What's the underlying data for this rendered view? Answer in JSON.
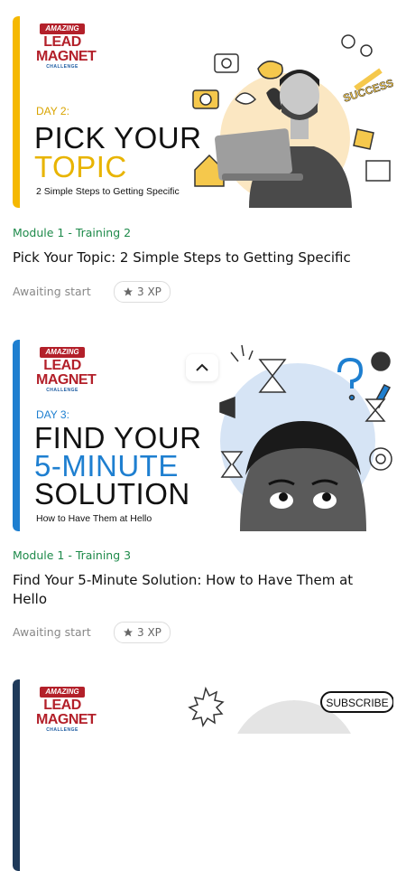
{
  "colors": {
    "accent_yellow": "#f5b800",
    "accent_blue": "#1e7fd0",
    "module_green": "#1e8a4a"
  },
  "cards": [
    {
      "logo": {
        "line1": "AMAZING",
        "line2": "LEAD",
        "line3": "MAGNET",
        "line4": "CHALLENGE"
      },
      "day": "DAY 2:",
      "headline": [
        "PICK YOUR",
        "TOPIC"
      ],
      "tagline": "2 Simple Steps to Getting Specific",
      "module": "Module 1 - Training 2",
      "title": "Pick Your Topic: 2 Simple Steps to Getting Specific",
      "status": "Awaiting start",
      "xp": "3 XP"
    },
    {
      "logo": {
        "line1": "AMAZING",
        "line2": "LEAD",
        "line3": "MAGNET",
        "line4": "CHALLENGE"
      },
      "day": "DAY 3:",
      "headline": [
        "FIND YOUR",
        "5-MINUTE",
        "SOLUTION"
      ],
      "tagline": "How to Have Them at Hello",
      "module": "Module 1 - Training 3",
      "title": "Find Your 5-Minute Solution: How to Have Them at Hello",
      "status": "Awaiting start",
      "xp": "3 XP"
    },
    {
      "logo": {
        "line1": "AMAZING",
        "line2": "LEAD",
        "line3": "MAGNET",
        "line4": "CHALLENGE"
      },
      "art_text": "SUBSCRIBE"
    }
  ],
  "icons": [
    "star-icon",
    "chevron-up-icon"
  ]
}
